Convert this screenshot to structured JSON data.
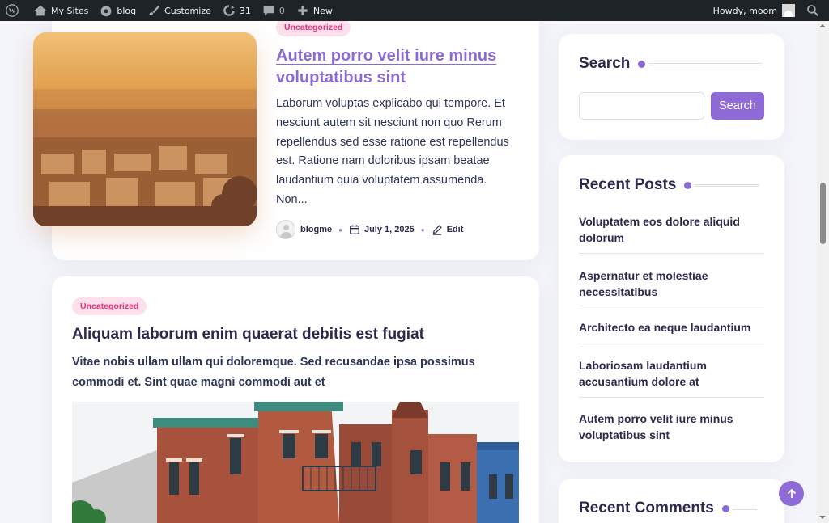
{
  "adminbar": {
    "my_sites": "My Sites",
    "site_name": "blog",
    "customize": "Customize",
    "updates_count": "31",
    "comments_count": "0",
    "new_label": "New",
    "howdy": "Howdy, moom"
  },
  "post1": {
    "category": "Uncategorized",
    "title": "Autem porro velit iure minus voluptatibus sint",
    "excerpt": "Laborum voluptas explicabo qui tempore. Et nesciunt autem sit nesciunt non quo Rerum repellendus sed esse ratione est repellendus est. Ratione nam doloribus ipsam beatae laudantium quia voluptatem assumenda. Non...",
    "author": "blogme",
    "date": "July 1, 2025",
    "edit_label": "Edit"
  },
  "post2": {
    "category": "Uncategorized",
    "title": "Aliquam laborum enim quaerat debitis est fugiat",
    "excerpt": "Vitae nobis ullam ullam qui doloremque. Sed recusandae ipsa possimus commodi et. Sint quae magni commodi aut et"
  },
  "sidebar": {
    "search_title": "Search",
    "search_button": "Search",
    "search_value": "",
    "recent_posts_title": "Recent Posts",
    "recent_posts": [
      "Voluptatem eos dolore aliquid dolorum",
      "Aspernatur et molestiae necessitatibus",
      "Architecto ea neque laudantium",
      "Laboriosam laudantium accusantium dolore at",
      "Autem porro velit iure minus voluptatibus sint"
    ],
    "recent_comments_title": "Recent Comments"
  },
  "colors": {
    "accent": "#8e6bd6",
    "badge_bg": "#fde0ec",
    "badge_text": "#e6317a",
    "adminbar_bg": "#1d2327"
  }
}
